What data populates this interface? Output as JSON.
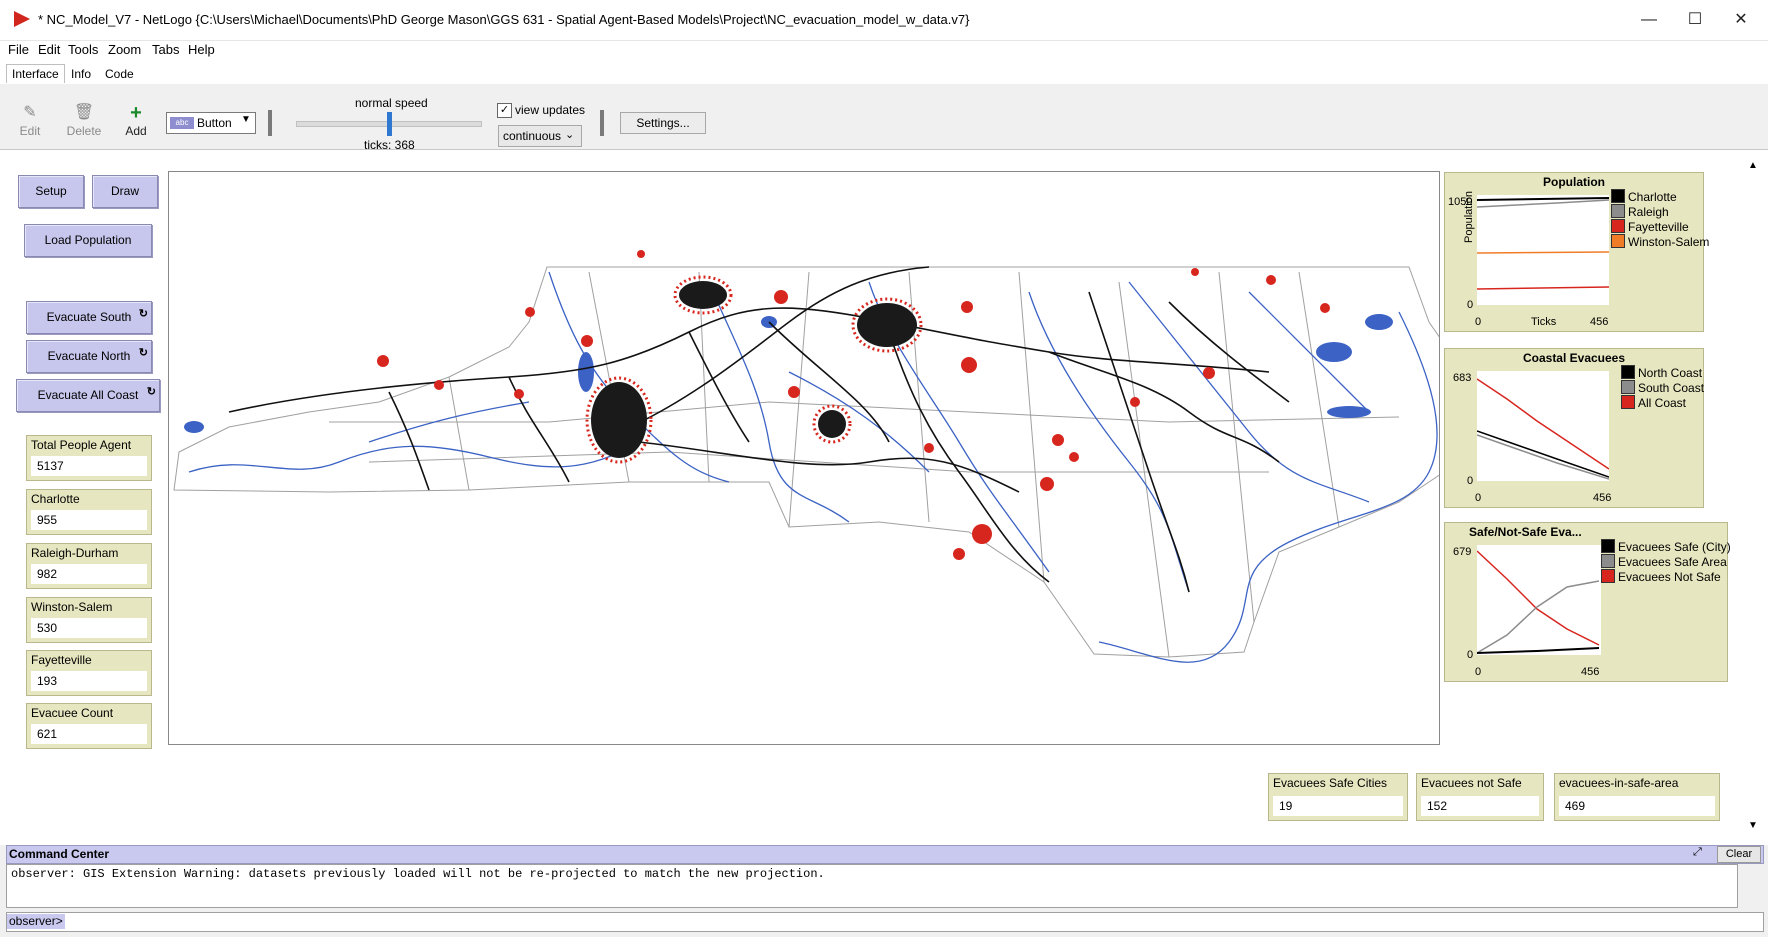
{
  "window": {
    "title": "* NC_Model_V7 - NetLogo {C:\\Users\\Michael\\Documents\\PhD George Mason\\GGS 631 - Spatial Agent-Based Models\\Project\\NC_evacuation_model_w_data.v7}",
    "minimize": "—",
    "maximize": "☐",
    "close": "✕"
  },
  "menu": [
    "File",
    "Edit",
    "Tools",
    "Zoom",
    "Tabs",
    "Help"
  ],
  "tabs": [
    "Interface",
    "Info",
    "Code"
  ],
  "toolbar": {
    "edit": "Edit",
    "delete": "Delete",
    "add": "Add",
    "widget_type": "Button",
    "speed_label": "normal speed",
    "ticks": "ticks: 368",
    "speed_level": 0.5,
    "view_updates": "view updates",
    "update_mode": "continuous",
    "settings": "Settings..."
  },
  "buttons": {
    "setup": "Setup",
    "draw": "Draw",
    "load_population": "Load Population",
    "evacuate_south": "Evacuate South",
    "evacuate_north": "Evacuate North",
    "evacuate_all_coast": "Evacuate All Coast"
  },
  "monitors": [
    {
      "label": "Total People Agent",
      "value": "5137"
    },
    {
      "label": "Charlotte",
      "value": "955"
    },
    {
      "label": "Raleigh-Durham",
      "value": "982"
    },
    {
      "label": "Winston-Salem",
      "value": "530"
    },
    {
      "label": "Fayetteville",
      "value": "193"
    },
    {
      "label": "Evacuee Count",
      "value": "621"
    }
  ],
  "bottom_monitors": [
    {
      "label": "Evacuees Safe Cities",
      "value": "19"
    },
    {
      "label": "Evacuees not Safe",
      "value": "152"
    },
    {
      "label": "evacuees-in-safe-area",
      "value": "469"
    }
  ],
  "plots": {
    "population": {
      "title": "Population",
      "ylabel": "Population",
      "xlabel": "Ticks",
      "ymax": "1050",
      "ymin": "0",
      "xmin": "0",
      "xmax": "456",
      "legend": [
        {
          "name": "Charlotte",
          "color": "#000000"
        },
        {
          "name": "Raleigh",
          "color": "#8c8c8c"
        },
        {
          "name": "Fayetteville",
          "color": "#d7261e"
        },
        {
          "name": "Winston-Salem",
          "color": "#f07c28"
        }
      ]
    },
    "coastal": {
      "title": "Coastal Evacuees",
      "ymax": "683",
      "ymin": "0",
      "xmin": "0",
      "xmax": "456",
      "legend": [
        {
          "name": "North Coast",
          "color": "#000000"
        },
        {
          "name": "South Coast",
          "color": "#8c8c8c"
        },
        {
          "name": "All Coast",
          "color": "#d7261e"
        }
      ]
    },
    "safe": {
      "title": "Safe/Not-Safe Eva...",
      "ymax": "679",
      "ymin": "0",
      "xmin": "0",
      "xmax": "456",
      "legend": [
        {
          "name": "Evacuees Safe (City)",
          "color": "#000000"
        },
        {
          "name": "Evacuees Safe Area",
          "color": "#8c8c8c"
        },
        {
          "name": "Evacuees Not Safe",
          "color": "#d7261e"
        }
      ]
    }
  },
  "command_center": {
    "title": "Command Center",
    "clear": "Clear",
    "output": "observer: GIS Extension Warning: datasets previously loaded will not be re-projected to match the new projection.",
    "prompt": "observer>"
  }
}
